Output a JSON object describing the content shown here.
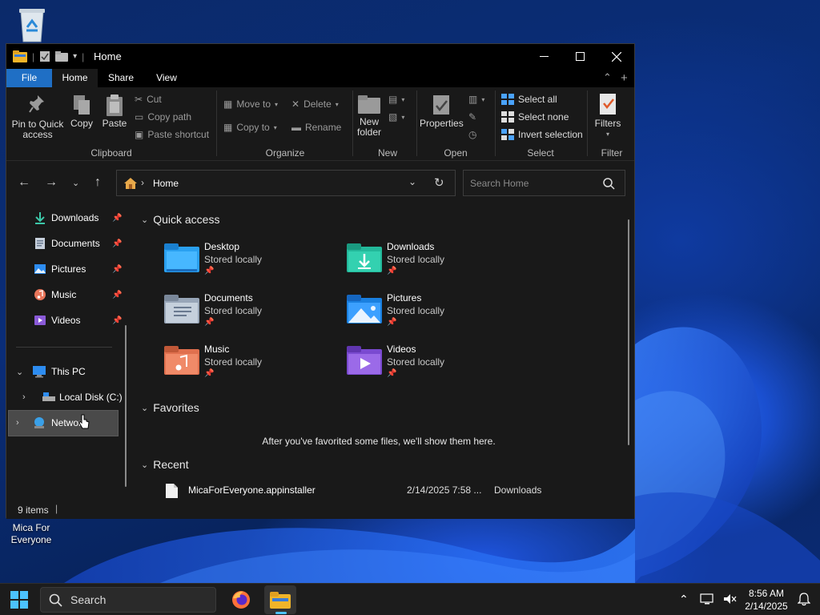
{
  "desktop": {
    "recycle_bin_icon": "recycle-bin-icon",
    "shortcut_label": "Mica For Everyone"
  },
  "window": {
    "title": "Home",
    "controls": {
      "minimize": "—",
      "maximize": "☐",
      "close": "✕"
    }
  },
  "tabs": {
    "file": "File",
    "home": "Home",
    "share": "Share",
    "view": "View"
  },
  "ribbon": {
    "clipboard": {
      "label": "Clipboard",
      "pin": "Pin to Quick access",
      "copy": "Copy",
      "paste": "Paste",
      "cut": "Cut",
      "copy_path": "Copy path",
      "paste_shortcut": "Paste shortcut"
    },
    "organize": {
      "label": "Organize",
      "move_to": "Move to",
      "copy_to": "Copy to",
      "delete": "Delete",
      "rename": "Rename"
    },
    "new": {
      "label": "New",
      "new_folder": "New folder"
    },
    "open": {
      "label": "Open",
      "properties": "Properties"
    },
    "select": {
      "label": "Select",
      "select_all": "Select all",
      "select_none": "Select none",
      "invert": "Invert selection"
    },
    "filter": {
      "label": "Filter",
      "filters": "Filters"
    }
  },
  "address": {
    "location": "Home",
    "search_placeholder": "Search Home"
  },
  "navpane": {
    "pinned": [
      {
        "label": "Downloads"
      },
      {
        "label": "Documents"
      },
      {
        "label": "Pictures"
      },
      {
        "label": "Music"
      },
      {
        "label": "Videos"
      }
    ],
    "this_pc": "This PC",
    "local_disk": "Local Disk (C:)",
    "network": "Network"
  },
  "content": {
    "quick_access": "Quick access",
    "tiles": [
      {
        "name": "Desktop",
        "sub": "Stored locally"
      },
      {
        "name": "Downloads",
        "sub": "Stored locally"
      },
      {
        "name": "Documents",
        "sub": "Stored locally"
      },
      {
        "name": "Pictures",
        "sub": "Stored locally"
      },
      {
        "name": "Music",
        "sub": "Stored locally"
      },
      {
        "name": "Videos",
        "sub": "Stored locally"
      }
    ],
    "favorites": "Favorites",
    "favorites_empty": "After you've favorited some files, we'll show them here.",
    "recent": "Recent",
    "recent_items": [
      {
        "name": "MicaForEveryone.appinstaller",
        "date": "2/14/2025 7:58 ...",
        "location": "Downloads"
      }
    ]
  },
  "status": {
    "items": "9 items"
  },
  "taskbar": {
    "search_label": "Search",
    "time": "8:56 AM",
    "date": "2/14/2025"
  },
  "colors": {
    "accent": "#1f6fc5",
    "window_bg": "#191919",
    "selection": "#4a4a4a"
  }
}
